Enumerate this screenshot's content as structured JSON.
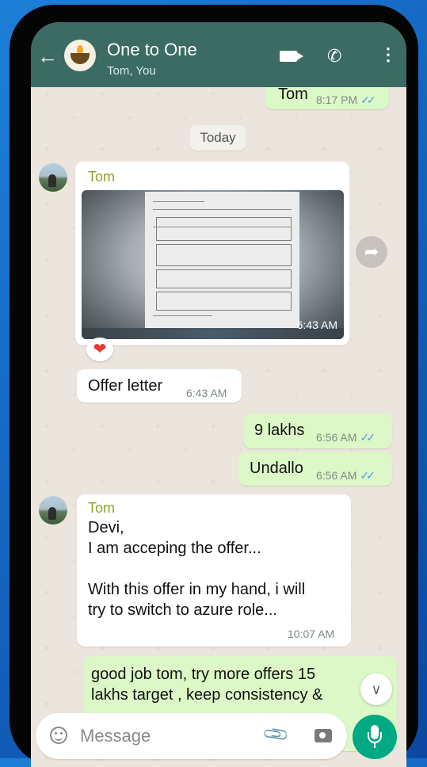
{
  "header": {
    "title": "One to One",
    "subtitle": "Tom, You",
    "icons": [
      "back-arrow-icon",
      "group-avatar-icon",
      "video-call-icon",
      "voice-call-icon",
      "more-options-icon"
    ]
  },
  "chat": {
    "date_chip": "Today",
    "messages": [
      {
        "sender": "",
        "direction": "out",
        "text": "Tom",
        "time": "8:17 PM",
        "ticks": "✓✓"
      },
      {
        "sender": "Tom",
        "direction": "in",
        "type": "image",
        "time": "6:43 AM",
        "reaction": "❤"
      },
      {
        "sender": "",
        "direction": "in",
        "text": "Offer letter",
        "time": "6:43 AM"
      },
      {
        "sender": "",
        "direction": "out",
        "text": "9 lakhs",
        "time": "6:56 AM",
        "ticks": "✓✓"
      },
      {
        "sender": "",
        "direction": "out",
        "text": "Undallo",
        "time": "6:56 AM",
        "ticks": "✓✓"
      },
      {
        "sender": "Tom",
        "direction": "in",
        "lines": [
          "Devi,",
          "I am acceping the offer...",
          "",
          "With this offer in my hand, i will",
          "try to switch to azure role..."
        ],
        "time": "10:07 AM"
      },
      {
        "sender": "",
        "direction": "out",
        "lines": [
          "good job tom, try more offers 15",
          "lakhs target , keep consistency &"
        ]
      }
    ]
  },
  "composer": {
    "placeholder": "Message"
  },
  "colors": {
    "header": "#3b6b63",
    "chat_bg": "#ece5dd",
    "outgoing": "#dcf8c6",
    "incoming": "#ffffff",
    "sender_name": "#8aa52a",
    "read_ticks": "#4fa0e8",
    "mic_button": "#00a884"
  }
}
